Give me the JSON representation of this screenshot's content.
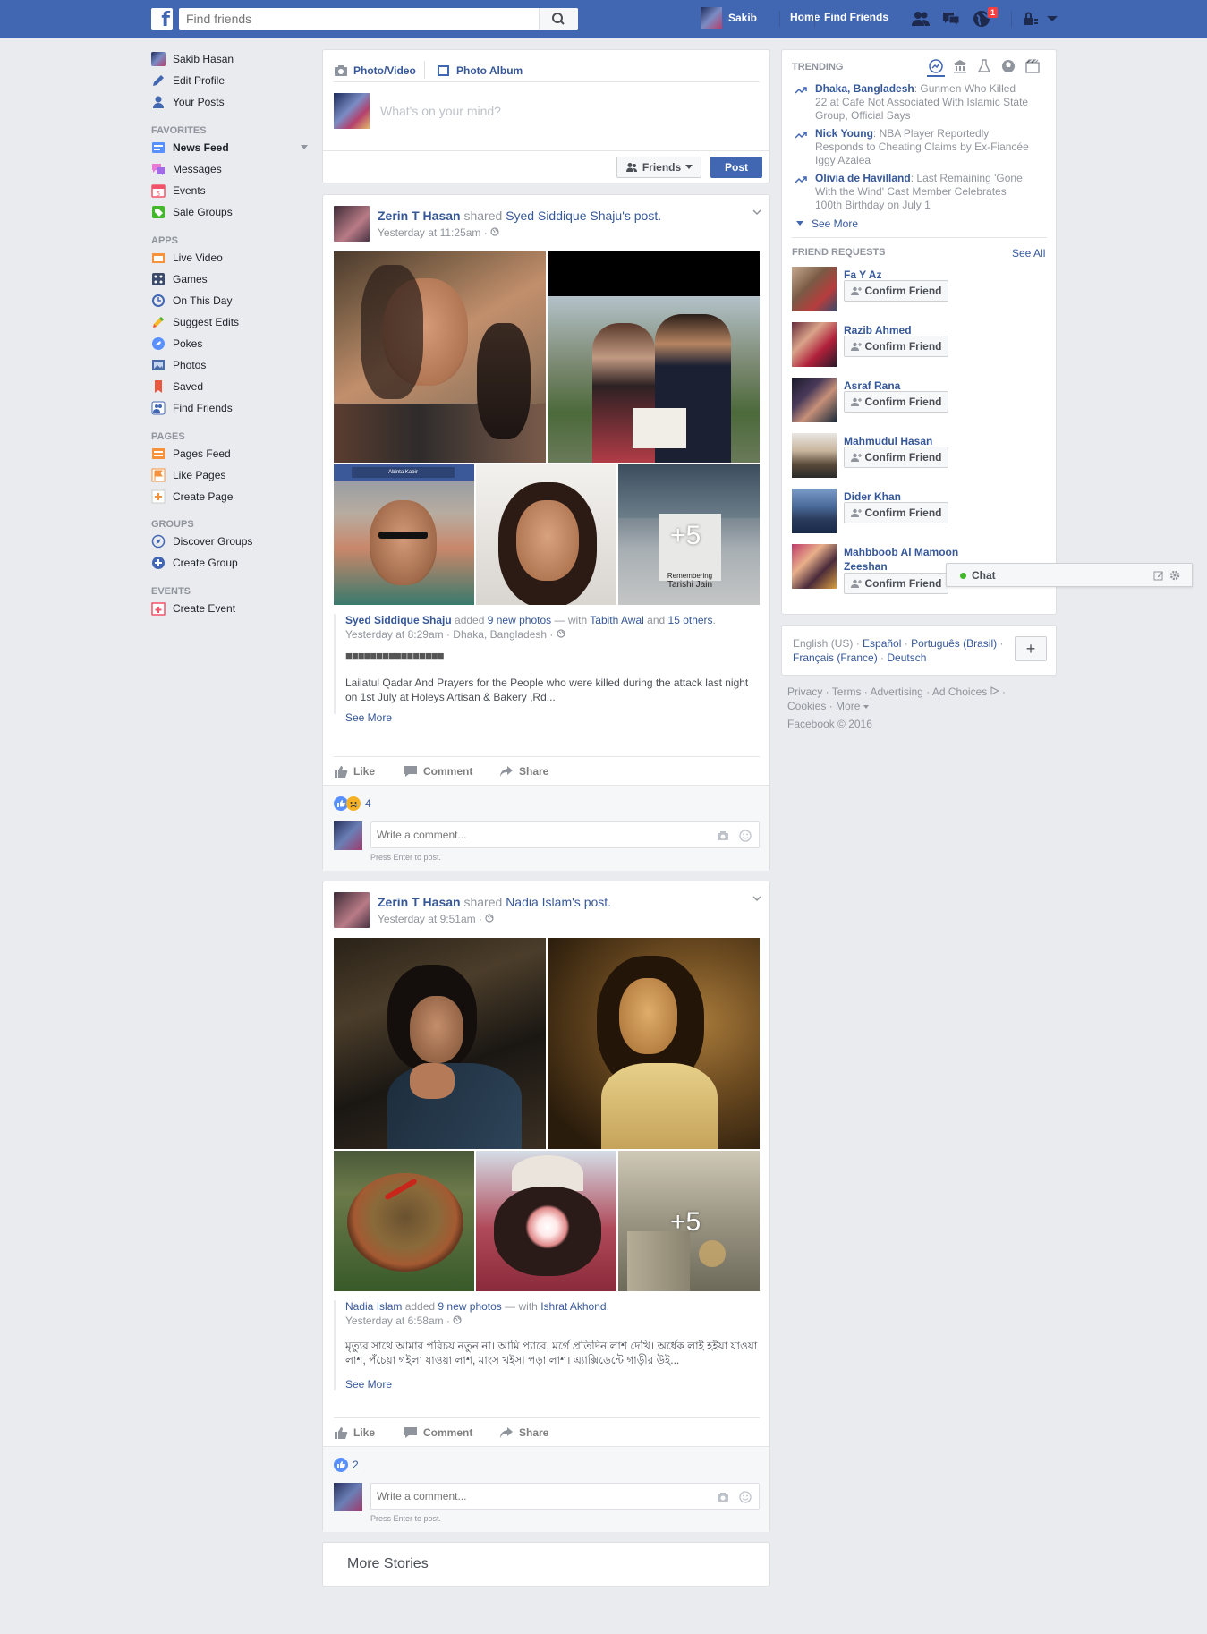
{
  "topbar": {
    "logo": "f",
    "search_placeholder": "Find friends",
    "user_name": "Sakib",
    "nav_home": "Home",
    "nav_find_friends": "Find Friends",
    "notification_count": "1"
  },
  "left_nav": {
    "profile": "Sakib Hasan",
    "edit_profile": "Edit Profile",
    "your_posts": "Your Posts",
    "favorites_heading": "FAVORITES",
    "favorites": [
      "News Feed",
      "Messages",
      "Events",
      "Sale Groups"
    ],
    "apps_heading": "APPS",
    "apps": [
      "Live Video",
      "Games",
      "On This Day",
      "Suggest Edits",
      "Pokes",
      "Photos",
      "Saved",
      "Find Friends"
    ],
    "pages_heading": "PAGES",
    "pages": [
      "Pages Feed",
      "Like Pages",
      "Create Page"
    ],
    "groups_heading": "GROUPS",
    "groups": [
      "Discover Groups",
      "Create Group"
    ],
    "events_heading": "EVENTS",
    "events": [
      "Create Event"
    ]
  },
  "composer": {
    "tab_photo_video": "Photo/Video",
    "tab_photo_album": "Photo Album",
    "placeholder": "What's on your mind?",
    "audience": "Friends",
    "post_button": "Post"
  },
  "posts": [
    {
      "author": "Zerin T Hasan",
      "verb": "shared",
      "shared_from": "Syed Siddique Shaju",
      "possessive": "'s",
      "post_word": "post.",
      "time": "Yesterday at 11:25am",
      "more_count": "+5",
      "overlay_title": "Remembering",
      "overlay_name": "Tarishi Jain",
      "mini_search": "Abinta Kabir",
      "inner_author": "Syed Siddique Shaju",
      "inner_added": "added",
      "inner_photos": "9 new photos",
      "inner_with": "— with",
      "inner_tag": "Tabith Awal",
      "inner_and": "and",
      "inner_others": "15 others",
      "inner_period": ".",
      "inner_time": "Yesterday at 8:29am · Dhaka, Bangladesh ·",
      "inner_blocks": "■■■■■■■■■■■■■■■■",
      "inner_body": "Lailatul Qadar And Prayers for the People who were killed during the attack last night on 1st July at Holeys Artisan & Bakery ,Rd...",
      "see_more": "See More",
      "reaction_count": "4"
    },
    {
      "author": "Zerin T Hasan",
      "verb": "shared",
      "shared_from": "Nadia Islam",
      "possessive": "'s",
      "post_word": "post.",
      "time": "Yesterday at 9:51am",
      "more_count": "+5",
      "inner_author": "Nadia Islam",
      "inner_added": "added",
      "inner_photos": "9 new photos",
      "inner_with": "— with",
      "inner_tag": "Ishrat Akhond",
      "inner_period": ".",
      "inner_time": "Yesterday at 6:58am ·",
      "inner_body": "মৃত্যুর সাথে আমার পরিচয় নতুন না। আমি প্যাবে, মর্গে প্রতিদিন লাশ দেখি। অর্ধেক লাই হইয়া যাওয়া লাশ, পঁচেয়া গইলা যাওয়া লাশ, মাংস খইসা পড়া লাশ। এ্যাক্সিডেন্টে গাড়ীর উই...",
      "see_more": "See More",
      "reaction_count": "2"
    }
  ],
  "post_actions": {
    "like": "Like",
    "comment": "Comment",
    "share": "Share"
  },
  "comment_box": {
    "placeholder": "Write a comment...",
    "hint": "Press Enter to post."
  },
  "more_stories": "More Stories",
  "trending": {
    "heading": "TRENDING",
    "items": [
      {
        "topic": "Dhaka, Bangladesh",
        "sep": ": ",
        "text": "Gunmen Who Killed 22 at Cafe Not Associated With Islamic State Group, Official Says"
      },
      {
        "topic": "Nick Young",
        "sep": ": ",
        "text": "NBA Player Reportedly Responds to Cheating Claims by Ex-Fiancée Iggy Azalea"
      },
      {
        "topic": "Olivia de Havilland",
        "sep": ": ",
        "text": "Last Remaining 'Gone With the Wind' Cast Member Celebrates 100th Birthday on July 1"
      }
    ],
    "see_more": "See More"
  },
  "friend_requests": {
    "heading": "FRIEND REQUESTS",
    "see_all": "See All",
    "confirm_label": "Confirm Friend",
    "names": [
      "Fa Y Az",
      "Razib Ahmed",
      "Asraf Rana",
      "Mahmudul Hasan",
      "Dider Khan",
      "Mahbboob Al Mamoon Zeeshan"
    ]
  },
  "chat": {
    "label": "Chat"
  },
  "languages": {
    "current": "English (US)",
    "others": [
      "Español",
      "Português (Brasil)",
      "Français (France)",
      "Deutsch"
    ],
    "add": "+"
  },
  "footer": {
    "links": [
      "Privacy",
      "Terms",
      "Advertising",
      "Ad Choices",
      "Cookies",
      "More"
    ],
    "copyright": "Facebook © 2016"
  },
  "colors": {
    "brand": "#4267b2",
    "link": "#365899",
    "muted": "#90949c",
    "bg": "#e9ebee"
  }
}
